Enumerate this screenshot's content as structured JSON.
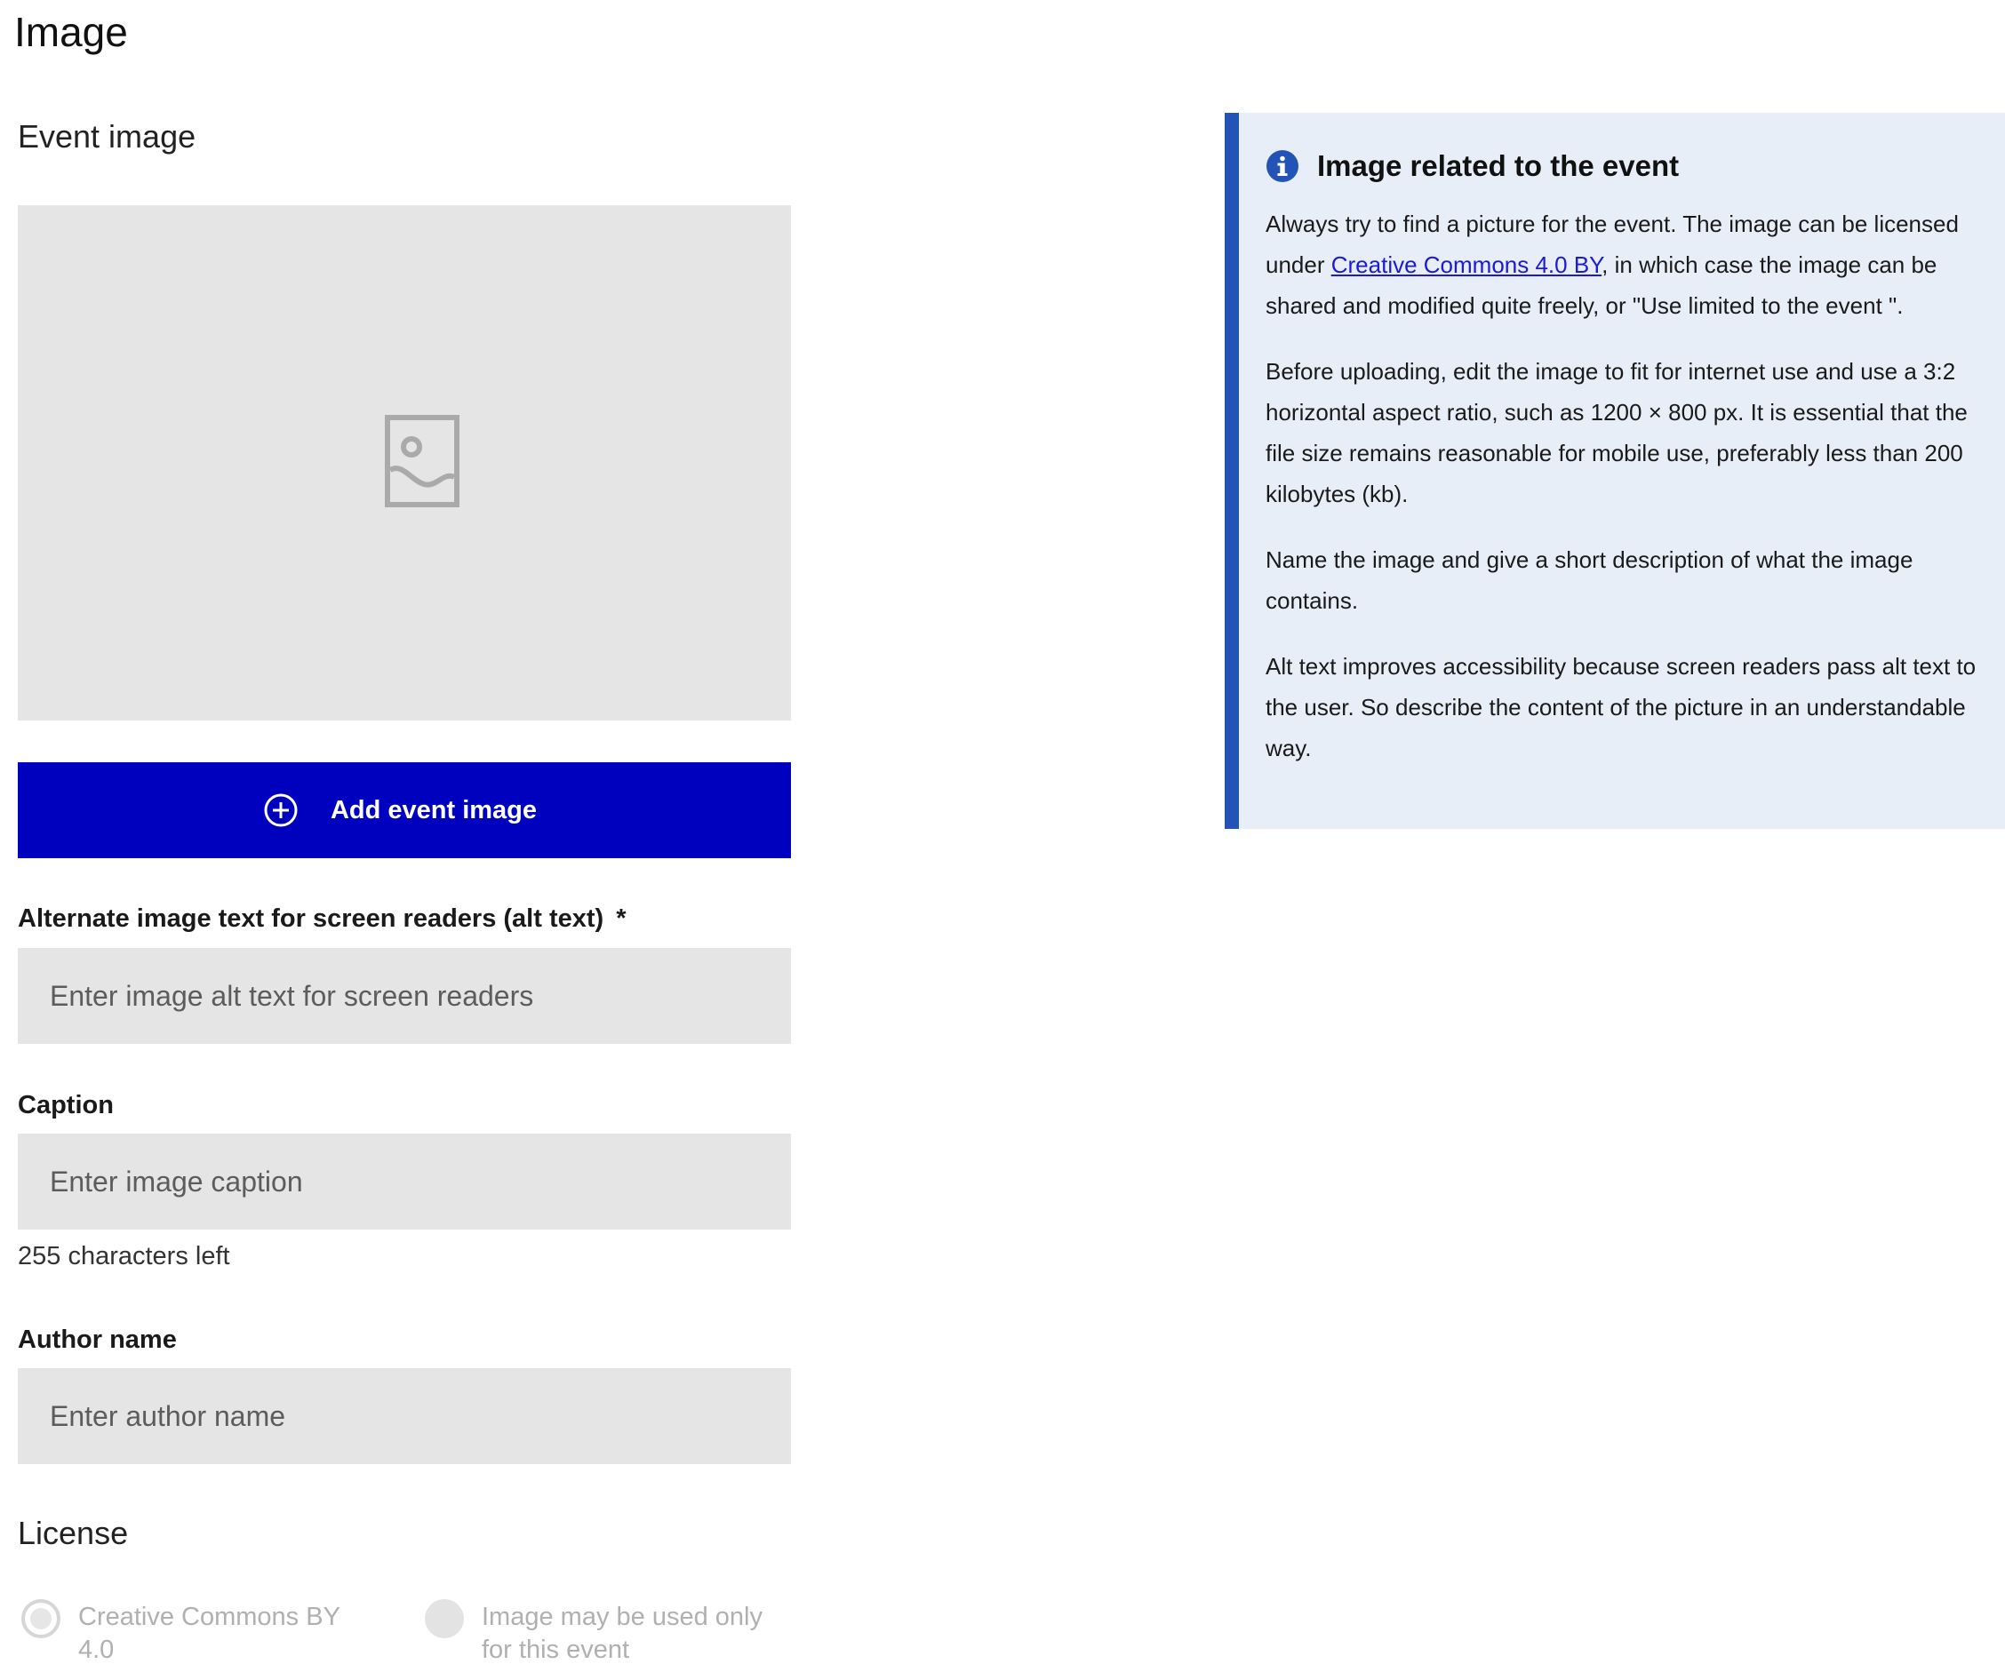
{
  "page": {
    "title": "Image"
  },
  "event_image": {
    "heading": "Event image",
    "placeholder_icon": "image-placeholder-icon",
    "add_button_label": "Add event image",
    "add_button_icon": "plus-circle-icon",
    "button_color": "#0000bf"
  },
  "alt_text": {
    "label": "Alternate image text for screen readers (alt text)",
    "required_marker": "*",
    "placeholder": "Enter image alt text for screen readers",
    "value": ""
  },
  "caption": {
    "label": "Caption",
    "placeholder": "Enter image caption",
    "value": "",
    "helper": "255 characters left"
  },
  "author": {
    "label": "Author name",
    "placeholder": "Enter author name",
    "value": ""
  },
  "license": {
    "heading": "License",
    "options": [
      {
        "label": "Creative Commons BY 4.0",
        "selected": true,
        "disabled": true
      },
      {
        "label": "Image may be used only for this event",
        "selected": false,
        "disabled": true
      }
    ]
  },
  "info_box": {
    "icon": "info-icon",
    "title": "Image related to the event",
    "accent_color": "#2353b6",
    "background_color": "#e8eef8",
    "para1_before": "Always try to find a picture for the event. The image can be licensed under ",
    "para1_link": "Creative Commons 4.0 BY",
    "para1_after": ", in which case the image can be shared and modified quite freely, or \"Use limited to the event \".",
    "para2": "Before uploading, edit the image to fit for internet use and use a 3:2 horizontal aspect ratio, such as 1200 × 800 px. It is essential that the file size remains reasonable for mobile use, preferably less than 200 kilobytes (kb).",
    "para3": "Name the image and give a short description of what the image contains.",
    "para4": "Alt text improves accessibility because screen readers pass alt text to the user. So describe the content of the picture in an understandable way."
  }
}
